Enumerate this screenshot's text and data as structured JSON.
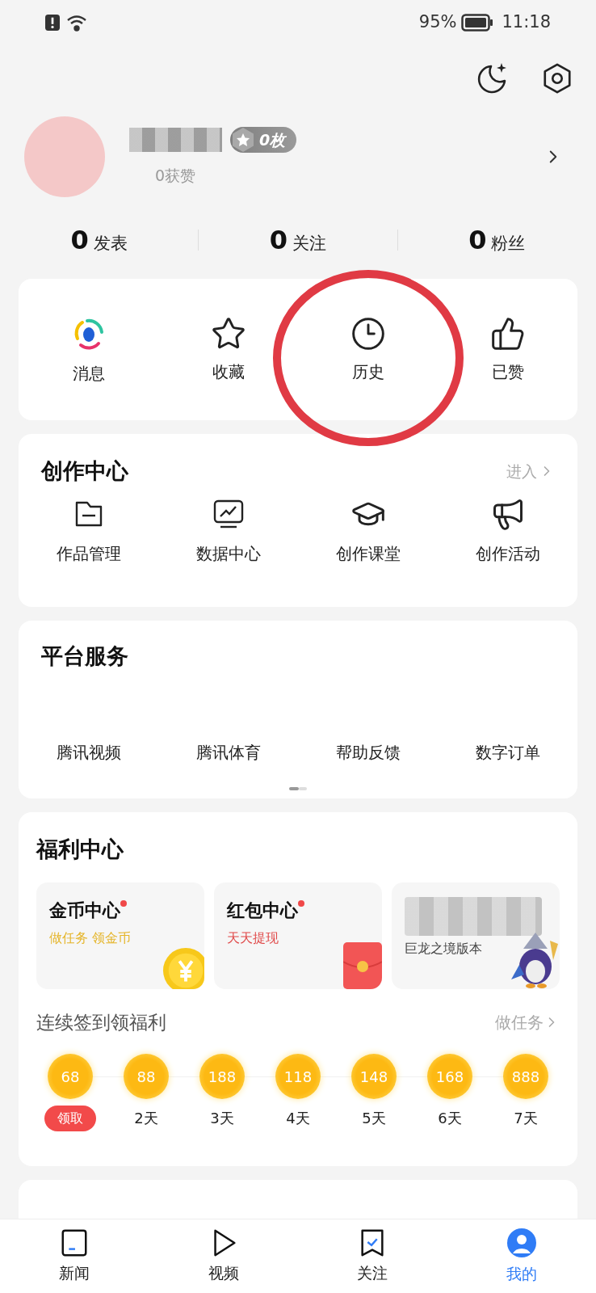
{
  "status_bar": {
    "battery": "95%",
    "time": "11:18"
  },
  "profile": {
    "badge": "0枚",
    "likes": "0获赞"
  },
  "stats": [
    {
      "count": "0",
      "label": "发表"
    },
    {
      "count": "0",
      "label": "关注"
    },
    {
      "count": "0",
      "label": "粉丝"
    }
  ],
  "shortcuts": [
    {
      "kind": "message",
      "label": "消息"
    },
    {
      "kind": "star",
      "label": "收藏"
    },
    {
      "kind": "history",
      "label": "历史"
    },
    {
      "kind": "like",
      "label": "已赞"
    }
  ],
  "creation": {
    "title": "创作中心",
    "link": "进入",
    "items": [
      {
        "kind": "works",
        "label": "作品管理"
      },
      {
        "kind": "data",
        "label": "数据中心"
      },
      {
        "kind": "class",
        "label": "创作课堂"
      },
      {
        "kind": "activity",
        "label": "创作活动"
      }
    ]
  },
  "platform": {
    "title": "平台服务",
    "items": [
      "腾讯视频",
      "腾讯体育",
      "帮助反馈",
      "数字订单"
    ]
  },
  "welfare": {
    "title": "福利中心",
    "cards": [
      {
        "kind": "coin",
        "title": "金币中心",
        "subtitle": "做任务 领金币"
      },
      {
        "kind": "redpack",
        "title": "红包中心",
        "subtitle": "天天提现"
      },
      {
        "kind": "promo",
        "subtitle": "巨龙之境版本"
      }
    ],
    "checkin_title": "连续签到领福利",
    "checkin_link": "做任务",
    "days": [
      {
        "amount": "68",
        "label": "领取",
        "kind": "claim"
      },
      {
        "amount": "88",
        "label": "2天",
        "kind": "day"
      },
      {
        "amount": "188",
        "label": "3天",
        "kind": "day"
      },
      {
        "amount": "118",
        "label": "4天",
        "kind": "day"
      },
      {
        "amount": "148",
        "label": "5天",
        "kind": "day"
      },
      {
        "amount": "168",
        "label": "6天",
        "kind": "day"
      },
      {
        "amount": "888",
        "label": "7天",
        "kind": "day"
      }
    ]
  },
  "nav": [
    {
      "kind": "news",
      "label": "新闻",
      "selected": false
    },
    {
      "kind": "video",
      "label": "视频",
      "selected": false
    },
    {
      "kind": "follow",
      "label": "关注",
      "selected": false
    },
    {
      "kind": "me",
      "label": "我的",
      "selected": true
    }
  ]
}
